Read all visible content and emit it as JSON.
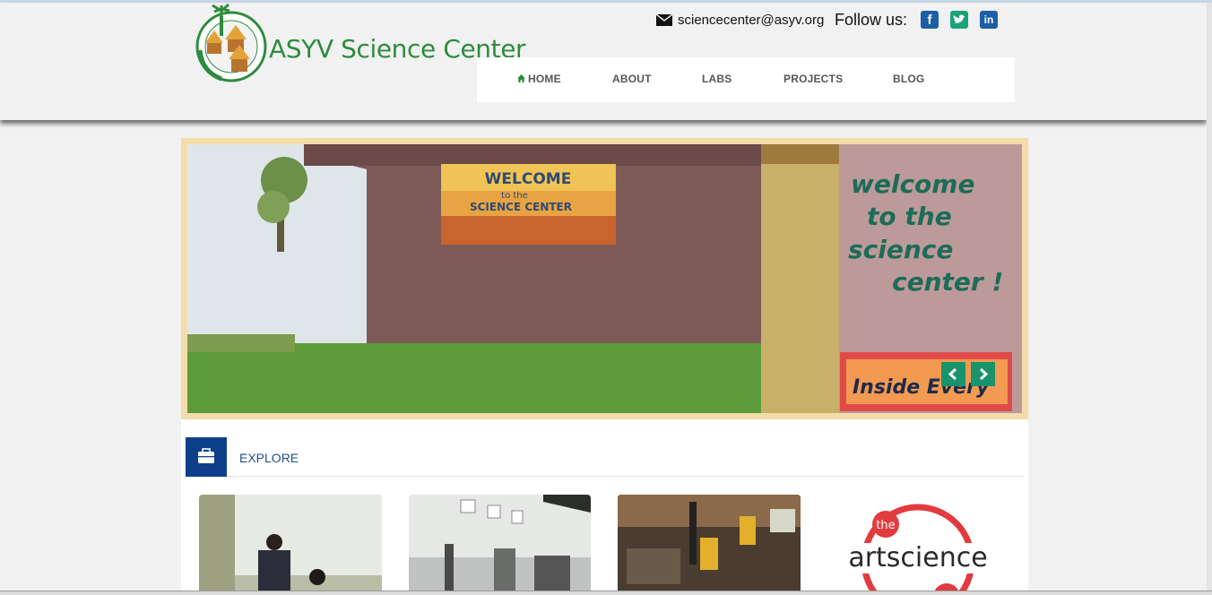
{
  "header": {
    "site_title": "ASYV Science Center",
    "email": "sciencecenter@asyv.org",
    "follow_label": "Follow us:",
    "social": {
      "facebook_icon": "facebook-icon",
      "twitter_icon": "twitter-icon",
      "linkedin_icon": "linkedin-icon"
    }
  },
  "nav": {
    "items": [
      {
        "label": "HOME",
        "icon": "home-icon"
      },
      {
        "label": "ABOUT"
      },
      {
        "label": "LABS"
      },
      {
        "label": "PROJECTS"
      },
      {
        "label": "BLOG"
      }
    ]
  },
  "slider": {
    "mural_text": "WELCOME to the SCIENCE CENTER",
    "wall_text_lines": [
      "welcome",
      "to the",
      "science",
      "center !"
    ],
    "sign_text": "Inside Every",
    "prev_icon": "chevron-left-icon",
    "next_icon": "chevron-right-icon"
  },
  "explore": {
    "label": "EXPLORE",
    "icon": "briefcase-icon"
  },
  "cards": {
    "artscience_small": "the",
    "artscience_word": "artscience"
  },
  "colors": {
    "brand_green": "#2e8b3d",
    "nav_bg": "#ffffff",
    "slider_border": "#f4dcaa",
    "arrow_bg": "#18936b",
    "explore_blue": "#0e3f8a",
    "social_blue": "#1d5fa6",
    "social_teal": "#1aa37a"
  }
}
